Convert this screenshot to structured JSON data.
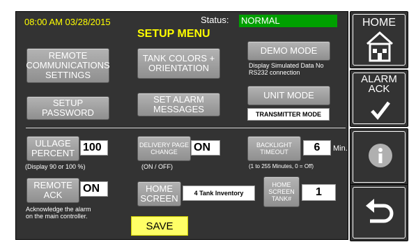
{
  "header": {
    "datetime": "08:00 AM 03/28/2015",
    "status_label": "Status:",
    "status_value": "NORMAL",
    "title": "SETUP MENU"
  },
  "buttons": {
    "remote_comm": "REMOTE COMMUNICATIONS SETTINGS",
    "tank_colors": "TANK COLORS + ORIENTATION",
    "demo_mode": "DEMO MODE",
    "setup_password": "SETUP PASSWORD",
    "set_alarm_messages": "SET ALARM MESSAGES",
    "unit_mode": "UNIT MODE",
    "ullage_percent": "ULLAGE PERCENT",
    "delivery_page_change": "DELIVERY PAGE CHANGE",
    "backlight_timeout": "BACKLIGHT TIMEOUT",
    "remote_ack": "REMOTE ACK",
    "home_screen": "HOME SCREEN",
    "home_screen_tank": "HOME SCREEN TANK#",
    "save": "SAVE"
  },
  "notes": {
    "demo_mode": "Display Simulated Data No RS232 connection",
    "ullage": "(Display 90 or 100 %)",
    "delivery": "(ON / OFF)",
    "backlight": "(1 to 255 Minutes, 0 = Off)",
    "remote_ack": "Acknowledge the alarm on the main controller.",
    "min_unit": "Min."
  },
  "values": {
    "unit_mode": "TRANSMITTER MODE",
    "ullage": "100",
    "delivery": "ON",
    "backlight": "6",
    "remote_ack": "ON",
    "home_screen": "4 Tank Inventory",
    "home_screen_tank": "1"
  },
  "side": {
    "home": "HOME",
    "alarm_ack": "ALARM ACK"
  },
  "colors": {
    "panel": "#333333",
    "button": "#9e9e9e",
    "status_green": "#00a000",
    "accent_yellow": "#ffff00",
    "save_bg": "#ffff66"
  },
  "icons": {
    "home": "house-icon",
    "alarm_ack": "checkmark-icon",
    "info": "info-icon",
    "back": "back-arrow-icon"
  }
}
